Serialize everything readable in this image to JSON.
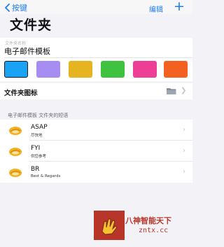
{
  "nav": {
    "back_label": "按键",
    "edit_label": "编辑",
    "add_label": "+"
  },
  "page": {
    "title": "文件夹"
  },
  "folder_name": {
    "label": "文件夹名称",
    "value": "电子邮件模板"
  },
  "colors": [
    {
      "name": "blue",
      "hex": "#1aa3f5",
      "selected": true
    },
    {
      "name": "purple",
      "hex": "#a78df2",
      "selected": false
    },
    {
      "name": "yellow",
      "hex": "#e6b321",
      "selected": false
    },
    {
      "name": "green",
      "hex": "#3fc23f",
      "selected": false
    },
    {
      "name": "pink",
      "hex": "#ee3f97",
      "selected": false
    },
    {
      "name": "orange",
      "hex": "#f2611f",
      "selected": false
    }
  ],
  "folder_icon": {
    "label": "文件夹图标",
    "icon": "folder-icon"
  },
  "section": {
    "header": "电子邮件模板 文件夹的短语"
  },
  "phrases": [
    {
      "title": "ASAP",
      "subtitle": "尽快地",
      "icon": "emoji-hand-icon"
    },
    {
      "title": "FYI",
      "subtitle": "供您参考",
      "icon": "emoji-hand-icon"
    },
    {
      "title": "BR",
      "subtitle": "Best & Regards",
      "icon": "emoji-hand-icon"
    }
  ],
  "watermark": {
    "text": "八神智能天下",
    "url": "zntx.cc"
  }
}
